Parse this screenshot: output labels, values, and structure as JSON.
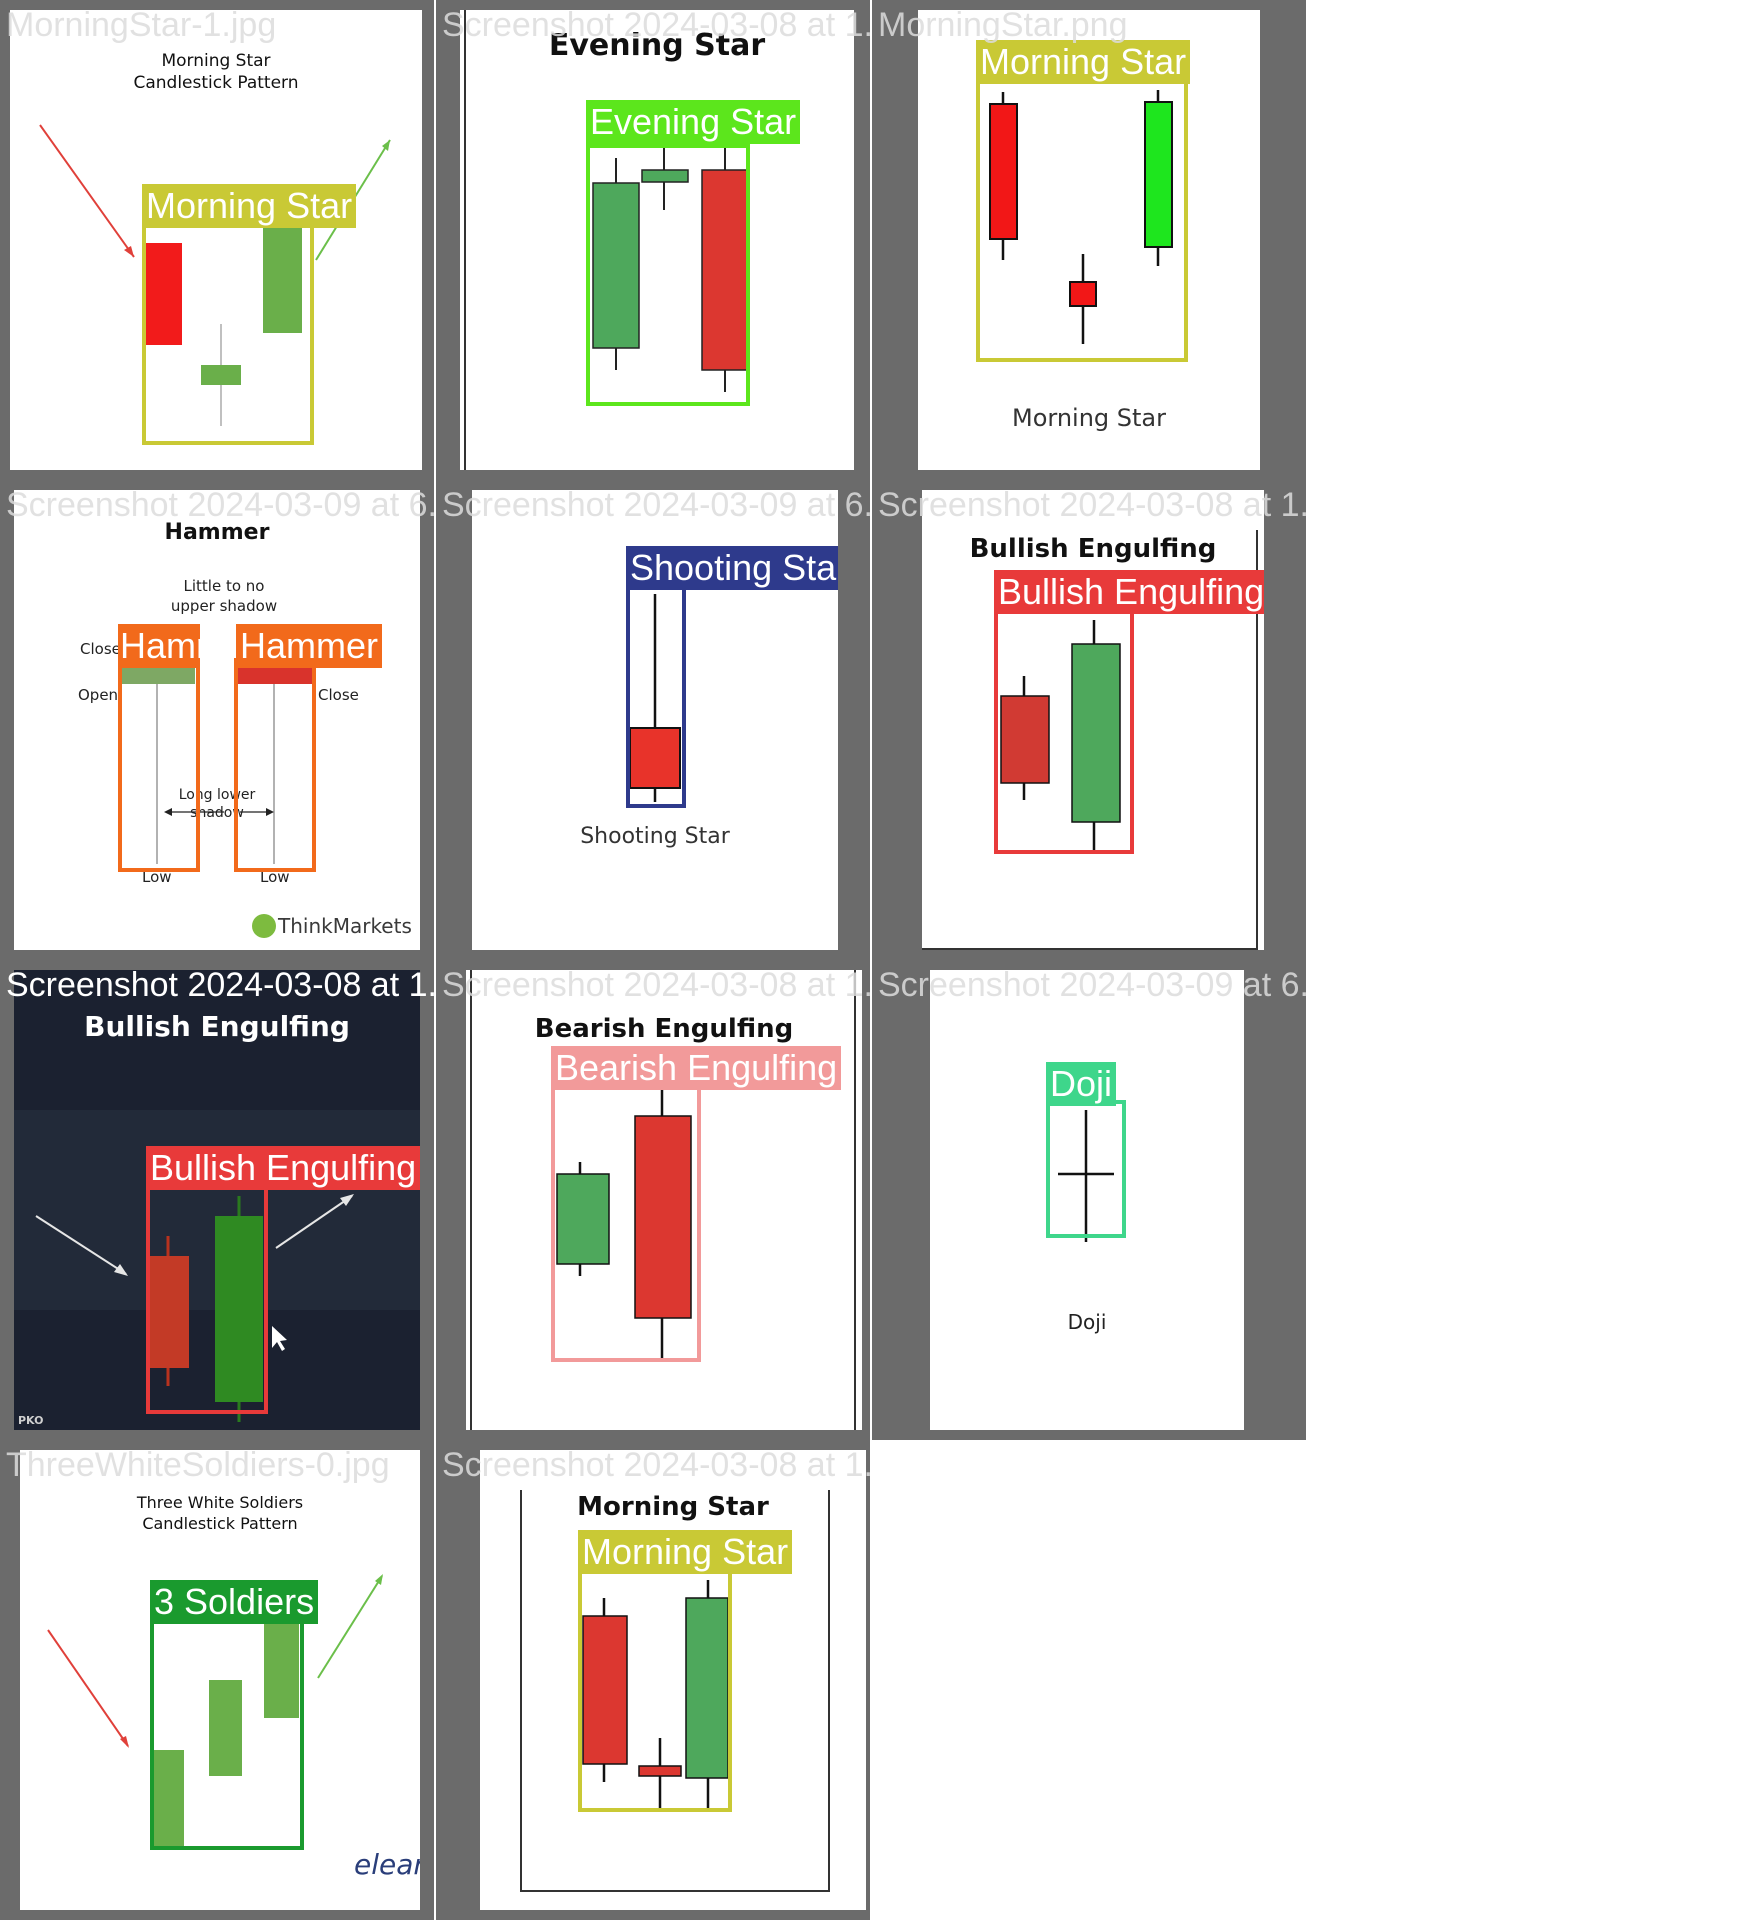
{
  "cells": [
    {
      "filename": "MorningStar-1.jpg",
      "title": "Morning Star Candlestick Pattern",
      "tag": "Morning Star",
      "tag_color": "#c9c935"
    },
    {
      "filename": "Screenshot 2024-03-08 at 1.55.43 PM.png",
      "title": "Evening Star",
      "tag": "Evening Star",
      "tag_color": "#5ce61c"
    },
    {
      "filename": "MorningStar.png",
      "caption": "Morning Star",
      "tag": "Morning Star",
      "tag_color": "#c9c935"
    },
    {
      "filename": "Screenshot 2024-03-09 at 6.08.13 PM.png",
      "title": "Hammer",
      "note": "Little to no upper shadow",
      "close_left": "Close",
      "open_left": "Open",
      "close_right": "Close",
      "lower_shadow": "Long lower shadow",
      "low_left": "Low",
      "low_right": "Low",
      "brand": "ThinkMarkets",
      "tag_left": "Hammer",
      "tag_right": "Hammer",
      "tag_color": "#f26a1b"
    },
    {
      "filename": "Screenshot 2024-03-09 at 6.06.02 PM.png",
      "caption": "Shooting Star",
      "tag": "Shooting Star",
      "tag_color": "#2e3a8c"
    },
    {
      "filename": "Screenshot 2024-03-08 at 1.55.18 PM.png",
      "title": "Bullish Engulfing",
      "tag": "Bullish Engulfing",
      "tag_color": "#e83a3a"
    },
    {
      "filename": "Screenshot 2024-03-08 at 1.59.44 PM.png",
      "title": "Bullish Engulfing",
      "tag": "Bullish Engulfing",
      "tag_color": "#e83a3a",
      "watermark": "PKO"
    },
    {
      "filename": "Screenshot 2024-03-08 at 1.55.40 PM.png",
      "title": "Bearish Engulfing",
      "tag": "Bearish Engulfing",
      "tag_color": "#f29a9a"
    },
    {
      "filename": "Screenshot 2024-03-09 at 6.06.10 PM.png",
      "caption": "Doji",
      "tag": "Doji",
      "tag_color": "#3ed68b"
    },
    {
      "filename": "ThreeWhiteSoldiers-0.jpg",
      "title": "Three White Soldiers Candlestick Pattern",
      "tag": "3 Soldiers",
      "tag_color": "#1a9a2e",
      "brand": "elearn"
    },
    {
      "filename": "Screenshot 2024-03-08 at 1.55.22 PM.png",
      "title": "Morning Star",
      "tag": "Morning Star",
      "tag_color": "#c9c935"
    }
  ]
}
